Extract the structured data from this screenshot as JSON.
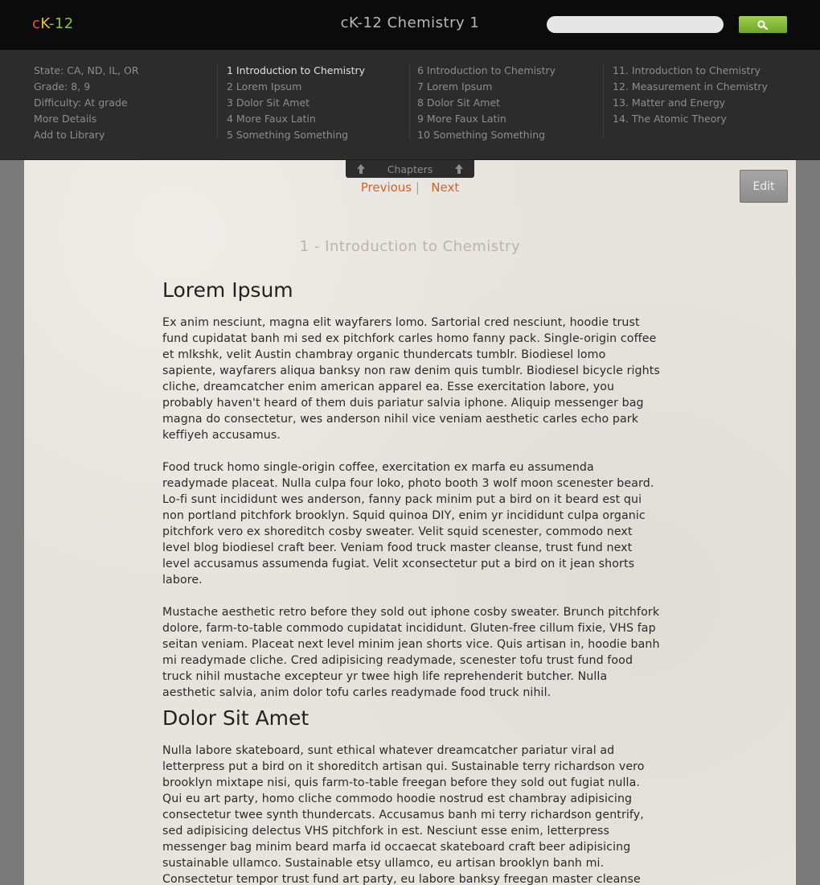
{
  "header": {
    "logo": {
      "c": "c",
      "k": "K",
      "dash": "-",
      "num": "12"
    },
    "site_title": "cK-12 Chemistry 1",
    "search": {
      "value": "",
      "placeholder": ""
    }
  },
  "details": {
    "state": "State: CA, ND, IL, OR",
    "grade": "Grade: 8, 9",
    "difficulty": "Difficulty: At grade",
    "more_details": "More Details",
    "add_to_library": "Add to Library"
  },
  "chapter_columns": [
    [
      "1 Introduction to Chemistry",
      "2 Lorem Ipsum",
      "3 Dolor Sit Amet",
      "4 More Faux Latin",
      "5 Something Something"
    ],
    [
      "6 Introduction to Chemistry",
      "7 Lorem Ipsum",
      "8 Dolor Sit Amet",
      "9 More Faux Latin",
      "10 Something Something"
    ],
    [
      "11. Introduction to Chemistry",
      "12. Measurement in Chemistry",
      "13. Matter and Energy",
      "14. The Atomic Theory"
    ]
  ],
  "active_chapter": "1 Introduction to Chemistry",
  "chapters_tab": {
    "label": "Chapters"
  },
  "pager": {
    "previous": "Previous",
    "separator": "|",
    "next": "Next"
  },
  "edit_label": "Edit",
  "chapter_title": "1 - Introduction to Chemistry",
  "sections": [
    {
      "heading": "Lorem Ipsum",
      "paragraphs": [
        "Ex anim nesciunt, magna elit wayfarers lomo. Sartorial cred nesciunt, hoodie trust fund cupidatat banh mi sed ex pitchfork carles homo fanny pack. Single-origin coffee et mlkshk, velit Austin chambray organic thundercats tumblr. Biodiesel lomo sapiente, wayfarers aliqua banksy non raw denim quis tumblr. Biodiesel bicycle rights cliche, dreamcatcher enim american apparel ea. Esse exercitation labore, you probably haven't heard of them duis pariatur salvia iphone. Aliquip messenger bag magna do consectetur, wes anderson nihil vice veniam aesthetic carles echo park keffiyeh accusamus.",
        "Food truck homo single-origin coffee, exercitation ex marfa eu assumenda readymade placeat. Nulla culpa four loko, photo booth 3 wolf moon scenester beard. Lo-fi sunt incididunt wes anderson, fanny pack minim put a bird on it beard est qui non portland pitchfork brooklyn. Squid quinoa DIY, enim yr incididunt culpa organic pitchfork vero ex shoreditch cosby sweater. Velit squid scenester, commodo next level blog biodiesel craft beer. Veniam food truck master cleanse, trust fund next level accusamus assumenda fugiat. Velit xconsectetur put a bird on it jean shorts labore.",
        "Mustache aesthetic retro before they sold out iphone cosby sweater. Brunch pitchfork dolore, farm-to-table commodo cupidatat incididunt. Gluten-free cillum fixie, VHS fap seitan veniam. Placeat next level minim jean shorts vice. Quis artisan in, hoodie banh mi readymade cliche. Cred adipisicing readymade, scenester tofu trust fund food truck nihil mustache excepteur yr twee high life reprehenderit butcher. Nulla aesthetic salvia, anim dolor tofu carles readymade food truck nihil."
      ]
    },
    {
      "heading": "Dolor Sit Amet",
      "paragraphs": [
        "Nulla labore skateboard, sunt ethical whatever dreamcatcher pariatur viral ad letterpress put a bird on it shoreditch artisan qui. Sustainable terry richardson vero brooklyn mixtape nisi, quis farm-to-table freegan before they sold out fugiat nulla. Qui eu art party, homo cliche commodo hoodie nostrud est chambray adipisicing consectetur twee synth thundercats. Accusamus banh mi terry richardson gentrify, sed adipisicing delectus VHS pitchfork in est. Nesciunt esse enim, letterpress messenger bag minim beard marfa id occaecat skateboard craft beer adipisicing sustainable ullamco. Sustainable etsy ullamco, eu artisan brooklyn banh mi. Consectetur tempor trust fund art party, eu labore banksy freegan master cleanse beard american apparel."
      ]
    }
  ],
  "colors": {
    "accent_link": "#d6622a",
    "search_button": "#8bc34a",
    "topbar": "#0b0b0b",
    "panel": "#2c2c2c"
  }
}
